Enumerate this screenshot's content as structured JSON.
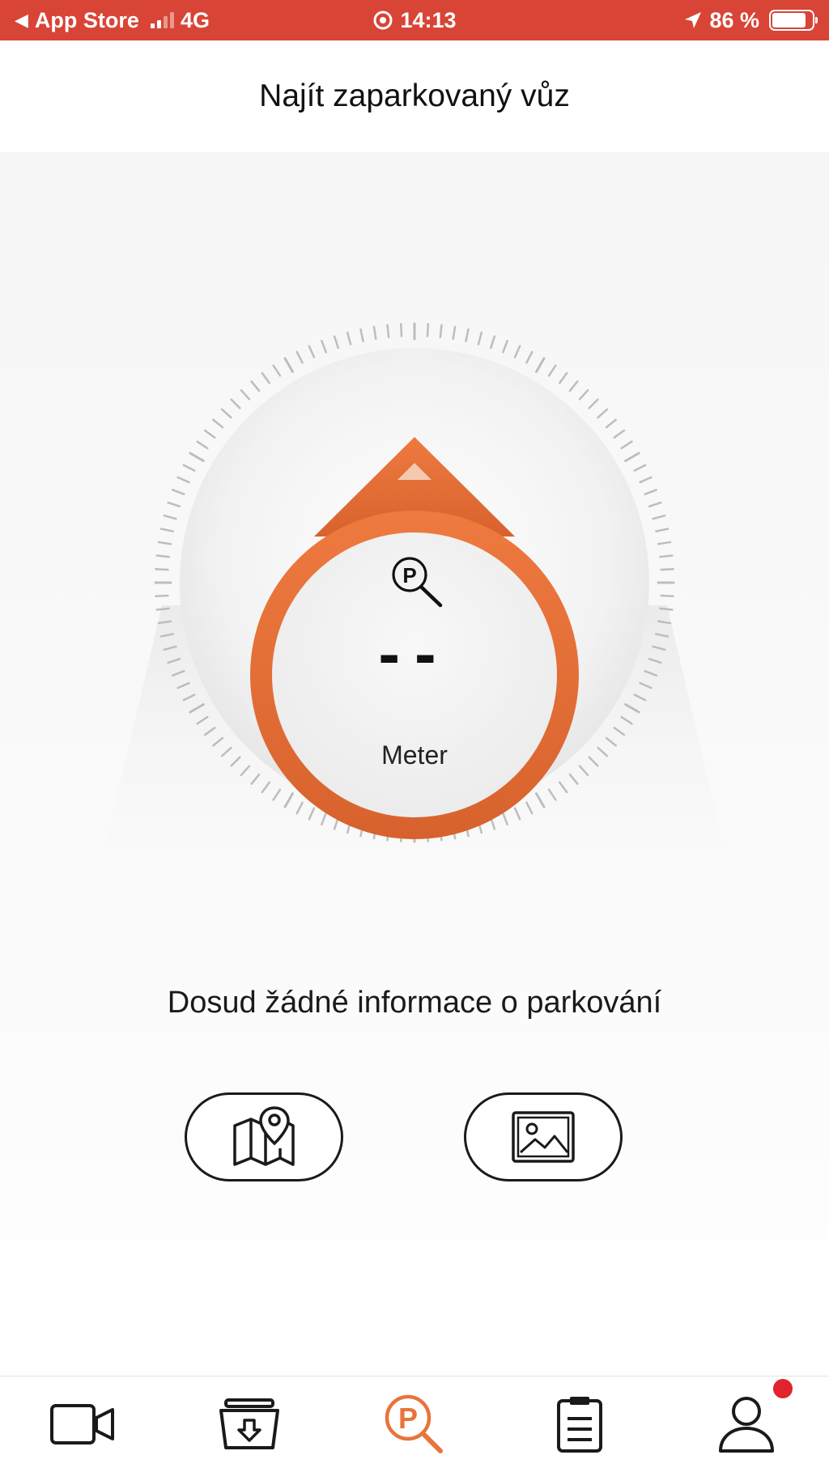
{
  "colors": {
    "status_bar": "#d84436",
    "accent": "#e8743b",
    "badge": "#e0232c",
    "text": "#111111"
  },
  "status_bar": {
    "back_app": "App Store",
    "network": "4G",
    "time": "14:13",
    "battery": "86 %",
    "battery_level": 0.86
  },
  "header": {
    "title": "Najít zaparkovaný vůz"
  },
  "dial": {
    "icon": "parking-search-icon",
    "value": "--",
    "unit": "Meter"
  },
  "message": "Dosud žádné informace o parkování",
  "actions": [
    {
      "icon": "map-pin-icon"
    },
    {
      "icon": "image-icon"
    }
  ],
  "tabs": [
    {
      "icon": "video-camera-icon",
      "active": false
    },
    {
      "icon": "download-box-icon",
      "active": false
    },
    {
      "icon": "parking-search-icon",
      "active": true
    },
    {
      "icon": "clipboard-icon",
      "active": false
    },
    {
      "icon": "user-icon",
      "active": false,
      "badge": true
    }
  ]
}
